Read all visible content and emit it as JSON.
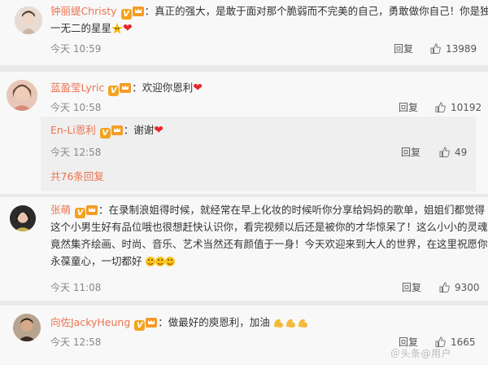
{
  "comments": [
    {
      "username": "钟丽缇Christy",
      "separator": "：",
      "text_line1": "真正的强大，是敢于面对那个脆弱而不完美的自己，勇敢做你自己！你是独",
      "text_line2": "一无二的星星",
      "time": "今天 10:59",
      "reply_label": "回复",
      "likes": "13989"
    },
    {
      "username": "蓝盈莹Lyric",
      "separator": "：",
      "text_line1": "欢迎你恩利",
      "time": "今天 10:58",
      "reply_label": "回复",
      "likes": "10192",
      "reply": {
        "username": "En-Li恩利",
        "separator": "：",
        "text": "谢谢",
        "time": "今天 12:58",
        "reply_label": "回复",
        "likes": "49"
      },
      "more_replies": "共76条回复"
    },
    {
      "username": "张萌",
      "separator": "：",
      "text_line1": "在录制浪姐得时候，就经常在早上化妆的时候听你分享给妈妈的歌单，姐姐们都觉得",
      "text_line2": "这个小男生好有品位哦也很想赶快认识你，看完视频以后还是被你的才华惊呆了！这么小小的灵魂",
      "text_line3": "竟然集齐绘画、时尚、音乐、艺术当然还有颜值于一身！今天欢迎来到大人的世界，在这里祝愿你",
      "text_line4": "永葆童心，一切都好",
      "time": "今天 11:08",
      "reply_label": "回复",
      "likes": "9300"
    },
    {
      "username": "向佐JackyHeung",
      "separator": "：",
      "text_line1": "做最好的庾恩利，加油",
      "time": "今天 12:58",
      "reply_label": "回复",
      "likes": "1665"
    }
  ],
  "watermark": "＠头条@用户",
  "colors": {
    "username": "#eb7350",
    "background": "#f8f8f8",
    "reply_background": "#efefef"
  },
  "icons": [
    "vip-v-badge",
    "crown-badge",
    "heart-emoji",
    "star-emoji",
    "muscle-emoji",
    "thumbs-up-icon"
  ]
}
